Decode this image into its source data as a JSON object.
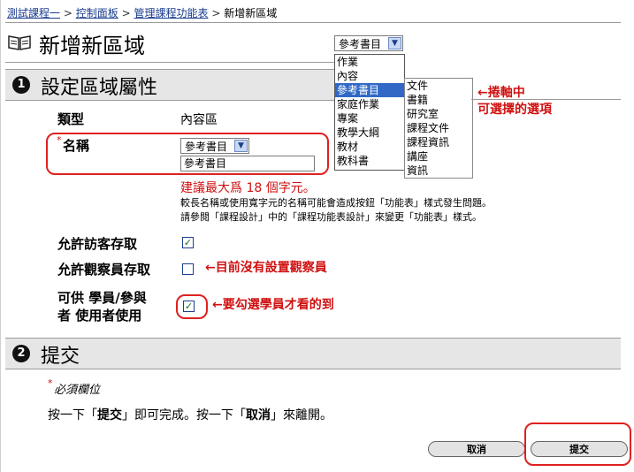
{
  "breadcrumb": {
    "items": [
      "測試課程一",
      "控制面板",
      "管理課程功能表",
      "新增新區域"
    ],
    "separator": ">"
  },
  "page": {
    "title": "新增新區域",
    "icon": "book-icon"
  },
  "top_select": {
    "value": "參考書目",
    "options": [
      "作業",
      "內容",
      "參考書目",
      "家庭作業",
      "專案",
      "教學大綱",
      "教材",
      "教科書"
    ],
    "selected_index": 2
  },
  "scroll_list": {
    "options": [
      "文件",
      "書籍",
      "研究室",
      "課程文件",
      "課程資訊",
      "講座",
      "資訊"
    ]
  },
  "annotation_scroll": {
    "line1": "←捲軸中",
    "line2": "可選擇的選項"
  },
  "section1": {
    "number": "❶",
    "title": "設定區域屬性"
  },
  "form": {
    "type_label": "類型",
    "type_value": "內容區",
    "name_required_mark": "*",
    "name_label": "名稱",
    "name_select_value": "參考書目",
    "name_input_value": "參考書目",
    "hint_red": "建議最大爲 18 個字元。",
    "hint_line2": "較長名稱或使用寬字元的名稱可能會造成按鈕「功能表」樣式發生問題。",
    "hint_line3": "請參閱「課程設計」中的「課程功能表設計」來變更「功能表」樣式。",
    "guest_label": "允許訪客存取",
    "guest_checked": true,
    "observer_label": "允許觀察員存取",
    "observer_checked": false,
    "student_label_1": "可供 學員/參與",
    "student_label_2": "者 使用者使用",
    "student_checked": true
  },
  "annotation_observer": "←目前沒有設置觀察員",
  "annotation_student": "←要勾選學員才看的到",
  "section2": {
    "number": "❷",
    "title": "提交"
  },
  "submit_area": {
    "required_note": "必須欄位",
    "required_mark": "*",
    "instruction_pre": "按一下「",
    "instruction_submit": "提交",
    "instruction_mid": "」即可完成。按一下「",
    "instruction_cancel": "取消",
    "instruction_post": "」來離開。",
    "cancel_label": "取消",
    "submit_label": "提交"
  },
  "colors": {
    "accent_red": "#d01010",
    "link": "#1a3d8f",
    "section_bg": "#e6e6e6",
    "selected": "#3168c6"
  }
}
